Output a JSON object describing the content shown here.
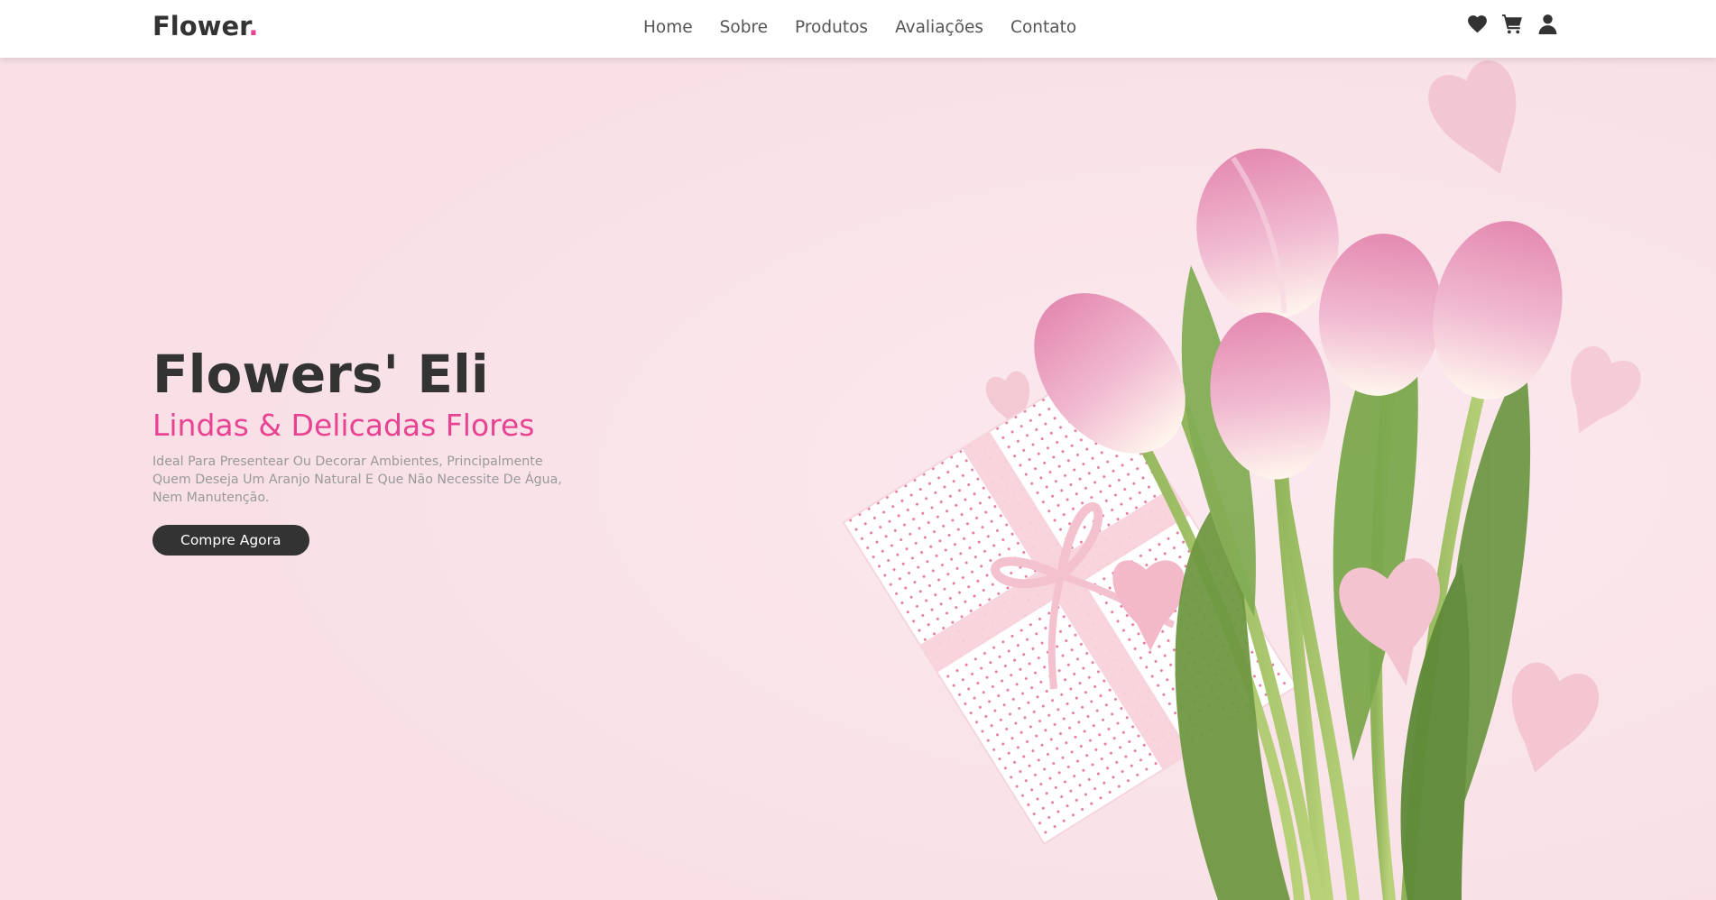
{
  "header": {
    "logo_text": "Flower",
    "logo_dot": ".",
    "nav": [
      "Home",
      "Sobre",
      "Produtos",
      "Avaliações",
      "Contato"
    ],
    "icons": [
      "heart-icon",
      "cart-icon",
      "user-icon"
    ]
  },
  "hero": {
    "title": "Flowers' Eli",
    "subtitle": "Lindas & Delicadas Flores",
    "description": "Ideal Para Presentear Ou Decorar Ambientes, Principalmente Quem Deseja Um Aranjo Natural E Que Não Necessite De Água, Nem Manutenção.",
    "button_label": "Compre Agora"
  },
  "colors": {
    "accent": "#e84393",
    "dark": "#333333",
    "background": "#f8e0e6",
    "muted_text": "#999999"
  }
}
